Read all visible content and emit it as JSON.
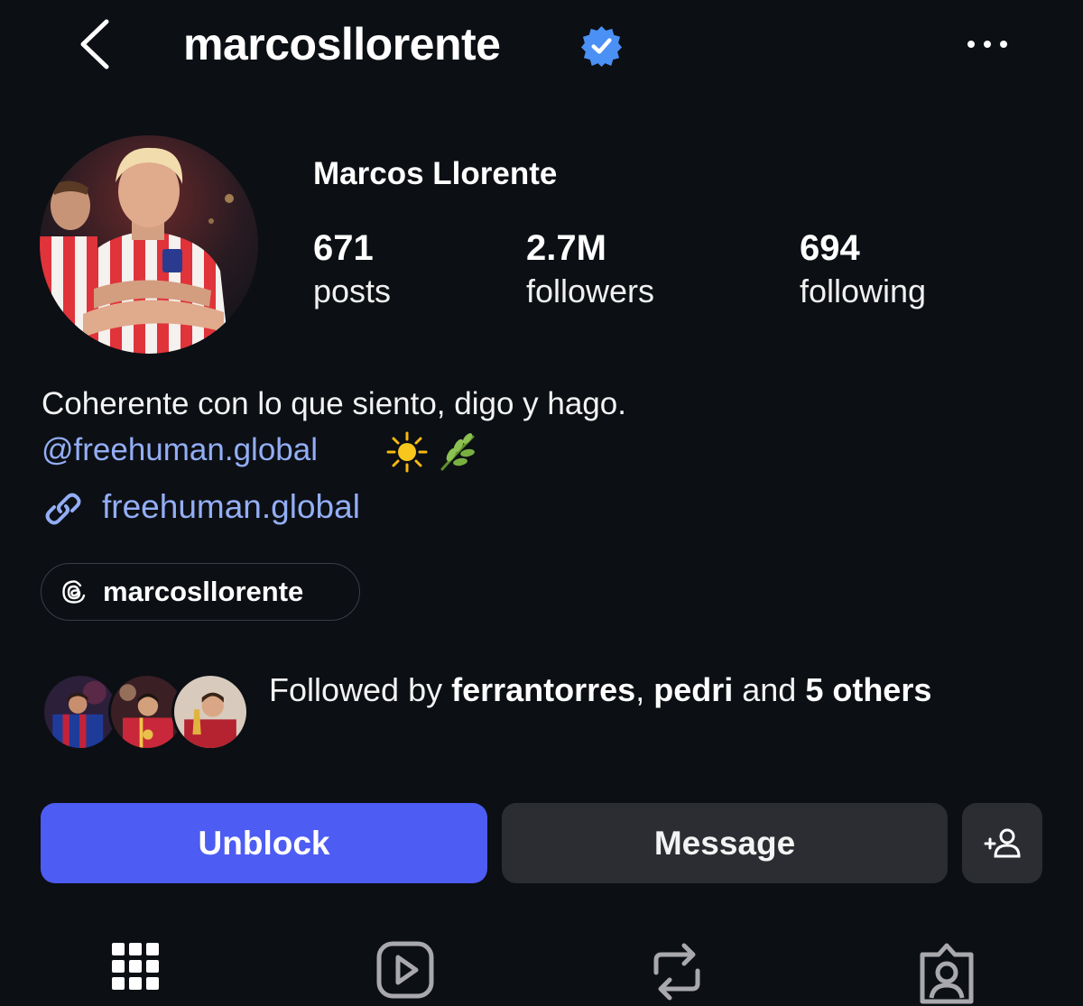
{
  "header": {
    "username": "marcosllorente",
    "verified": true,
    "back_icon": "chevron-left-icon",
    "more_icon": "ellipsis-icon"
  },
  "profile": {
    "full_name": "Marcos Llorente",
    "stats": [
      {
        "value": "671",
        "label": "posts"
      },
      {
        "value": "2.7M",
        "label": "followers"
      },
      {
        "value": "694",
        "label": "following"
      }
    ],
    "bio": "Coherente con lo que siento, digo y hago.",
    "mention": "@freehuman.global",
    "emoji": [
      "sun-icon",
      "herb-icon"
    ],
    "link": "freehuman.global",
    "threads_handle": "marcosllorente"
  },
  "mutuals": {
    "prefix": "Followed by ",
    "user_1": "ferrantorres",
    "separator": ", ",
    "user_2": "pedri",
    "middle": " and ",
    "count_text": "5 others"
  },
  "actions": {
    "primary": "Unblock",
    "secondary": "Message",
    "add_icon": "add-person-icon"
  },
  "tabs": [
    "grid-icon",
    "reels-icon",
    "reposts-icon",
    "tagged-icon"
  ],
  "colors": {
    "background": "#0c0f14",
    "accent": "#4d5cf2",
    "link": "#93aef5",
    "verified": "#4a90f5",
    "button_secondary": "#2b2d33"
  }
}
